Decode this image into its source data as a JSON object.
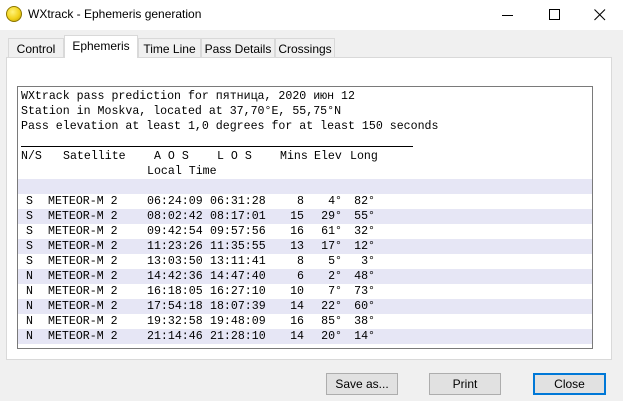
{
  "window": {
    "title": "WXtrack - Ephemeris generation"
  },
  "tabs": [
    "Control",
    "Ephemeris",
    "Time Line",
    "Pass Details",
    "Crossings"
  ],
  "active_tab": "Ephemeris",
  "report": {
    "header_lines": [
      "WXtrack pass prediction for пятница, 2020 июн 12",
      "Station in Moskva, located at 37,70°E, 55,75°N",
      "Pass elevation at least 1,0 degrees for at least 150 seconds"
    ],
    "columns": {
      "ns": "N/S",
      "satellite": "Satellite",
      "aos": "A O S",
      "los": "L O S",
      "mins": "Mins",
      "elev": "Elev",
      "long": "Long",
      "local_time": "Local Time"
    },
    "rows": [
      {
        "ns": "S",
        "satellite": "METEOR-M 2",
        "aos": "06:24:09",
        "los": "06:31:28",
        "mins": "8",
        "elev": "4°",
        "long": "82°"
      },
      {
        "ns": "S",
        "satellite": "METEOR-M 2",
        "aos": "08:02:42",
        "los": "08:17:01",
        "mins": "15",
        "elev": "29°",
        "long": "55°"
      },
      {
        "ns": "S",
        "satellite": "METEOR-M 2",
        "aos": "09:42:54",
        "los": "09:57:56",
        "mins": "16",
        "elev": "61°",
        "long": "32°"
      },
      {
        "ns": "S",
        "satellite": "METEOR-M 2",
        "aos": "11:23:26",
        "los": "11:35:55",
        "mins": "13",
        "elev": "17°",
        "long": "12°"
      },
      {
        "ns": "S",
        "satellite": "METEOR-M 2",
        "aos": "13:03:50",
        "los": "13:11:41",
        "mins": "8",
        "elev": "5°",
        "long": "3°"
      },
      {
        "ns": "N",
        "satellite": "METEOR-M 2",
        "aos": "14:42:36",
        "los": "14:47:40",
        "mins": "6",
        "elev": "2°",
        "long": "48°"
      },
      {
        "ns": "N",
        "satellite": "METEOR-M 2",
        "aos": "16:18:05",
        "los": "16:27:10",
        "mins": "10",
        "elev": "7°",
        "long": "73°"
      },
      {
        "ns": "N",
        "satellite": "METEOR-M 2",
        "aos": "17:54:18",
        "los": "18:07:39",
        "mins": "14",
        "elev": "22°",
        "long": "60°"
      },
      {
        "ns": "N",
        "satellite": "METEOR-M 2",
        "aos": "19:32:58",
        "los": "19:48:09",
        "mins": "16",
        "elev": "85°",
        "long": "38°"
      },
      {
        "ns": "N",
        "satellite": "METEOR-M 2",
        "aos": "21:14:46",
        "los": "21:28:10",
        "mins": "14",
        "elev": "20°",
        "long": "14°"
      }
    ]
  },
  "buttons": {
    "save": "Save as...",
    "print": "Print",
    "close": "Close"
  },
  "colors": {
    "accent": "#0078d7",
    "row_shade": "#e6e6f5"
  },
  "icons": {
    "app": "sun-icon",
    "minimize": "minimize-icon",
    "maximize": "maximize-icon",
    "close": "close-icon"
  }
}
